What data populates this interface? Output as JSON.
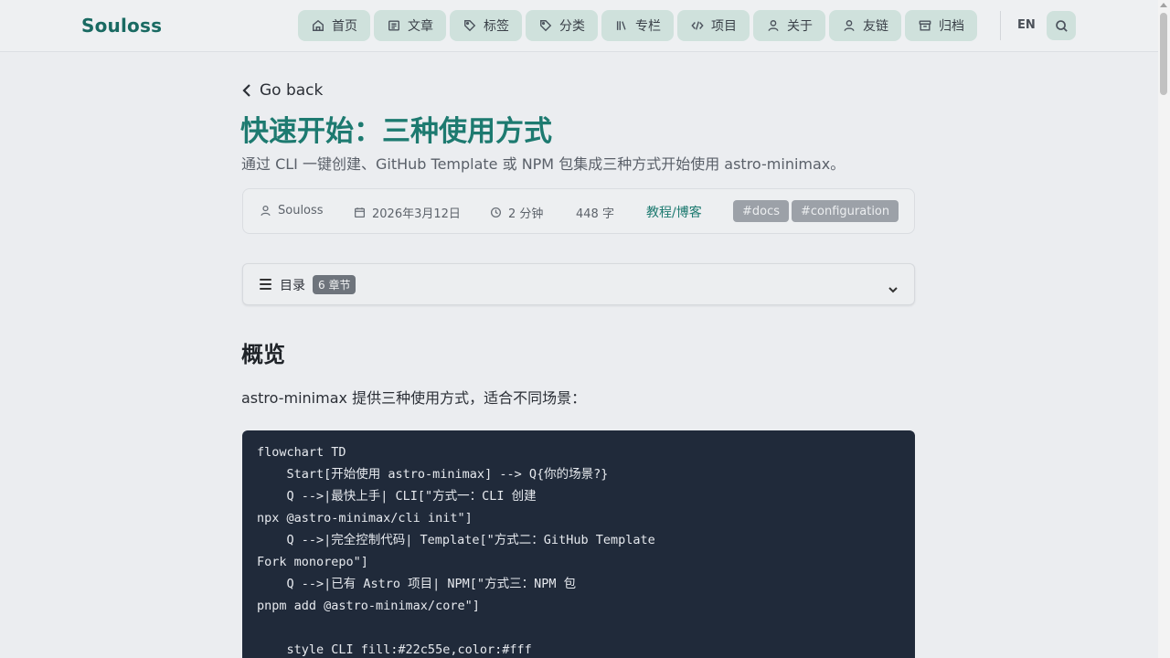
{
  "header": {
    "brand": "Souloss",
    "nav": [
      {
        "label": "首页",
        "icon": "home-icon"
      },
      {
        "label": "文章",
        "icon": "article-icon"
      },
      {
        "label": "标签",
        "icon": "tag-icon"
      },
      {
        "label": "分类",
        "icon": "category-icon"
      },
      {
        "label": "专栏",
        "icon": "book-icon"
      },
      {
        "label": "项目",
        "icon": "code-icon"
      },
      {
        "label": "关于",
        "icon": "user-icon"
      },
      {
        "label": "友链",
        "icon": "user-icon"
      },
      {
        "label": "归档",
        "icon": "archive-icon"
      }
    ],
    "lang": "EN",
    "search_icon": "search-icon"
  },
  "article": {
    "go_back": "Go back",
    "title": "快速开始：三种使用方式",
    "subtitle": "通过 CLI 一键创建、GitHub Template 或 NPM 包集成三种方式开始使用 astro-minimax。",
    "meta": {
      "author": "Souloss",
      "date": "2026年3月12日",
      "read_time": "2 分钟",
      "words": "448 字",
      "category": "教程/博客",
      "tags": [
        "#docs",
        "#configuration"
      ]
    },
    "toc": {
      "label": "目录",
      "badge": "6 章节"
    },
    "section_heading": "概览",
    "intro": "astro-minimax 提供三种使用方式，适合不同场景：",
    "code_lines": [
      "flowchart TD",
      "    Start[开始使用 astro-minimax] --> Q{你的场景?}",
      "    Q -->|最快上手| CLI[\"方式一：CLI 创建",
      "npx @astro-minimax/cli init\"]",
      "    Q -->|完全控制代码| Template[\"方式二：GitHub Template",
      "Fork monorepo\"]",
      "    Q -->|已有 Astro 项目| NPM[\"方式三：NPM 包",
      "pnpm add @astro-minimax/core\"]",
      "",
      "    style CLI fill:#22c55e,color:#fff"
    ]
  },
  "colors": {
    "accent": "#1d7a70",
    "nav_bg": "#cfe1dc",
    "code_bg": "#202a3a"
  }
}
